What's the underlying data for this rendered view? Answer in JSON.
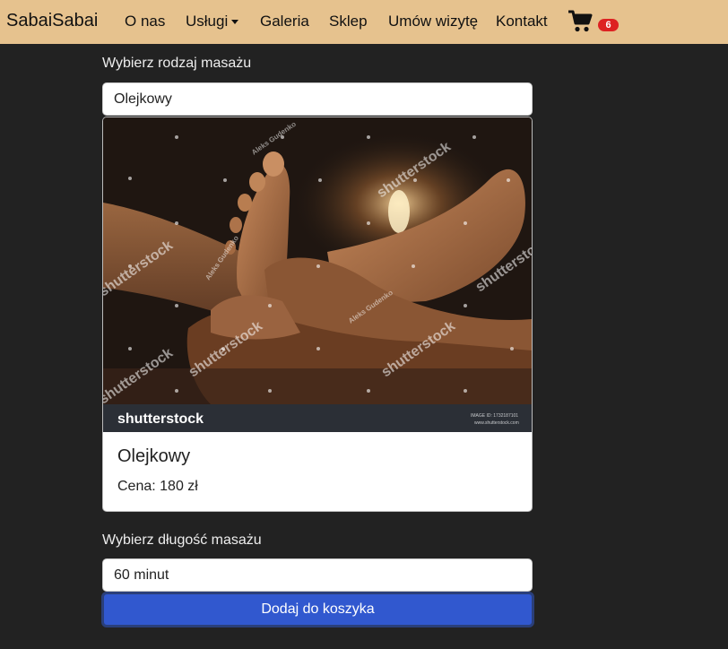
{
  "navbar": {
    "brand": "SabaiSabai",
    "items": [
      "O nas",
      "Usługi",
      "Galeria",
      "Sklep",
      "Umów wizytę",
      "Kontakt"
    ],
    "cart_count": "6",
    "cart_icon": "shopping-cart-icon"
  },
  "massage_type": {
    "label": "Wybierz rodzaj masażu",
    "selected": "Olejkowy"
  },
  "card": {
    "title": "Olejkowy",
    "price": "Cena: 180 zł",
    "image": {
      "brand": "shutterstock",
      "author": "Aleks Gudenko",
      "image_id": "IMAGE ID: 1732187101",
      "site": "www.shutterstock.com"
    }
  },
  "duration": {
    "label": "Wybierz długość masażu",
    "selected": "60 minut"
  },
  "add_button": "Dodaj do koszyka",
  "colors": {
    "navbar": "#e6c28e",
    "background": "#222222",
    "button": "#3158cf",
    "badge": "#dd2222"
  }
}
